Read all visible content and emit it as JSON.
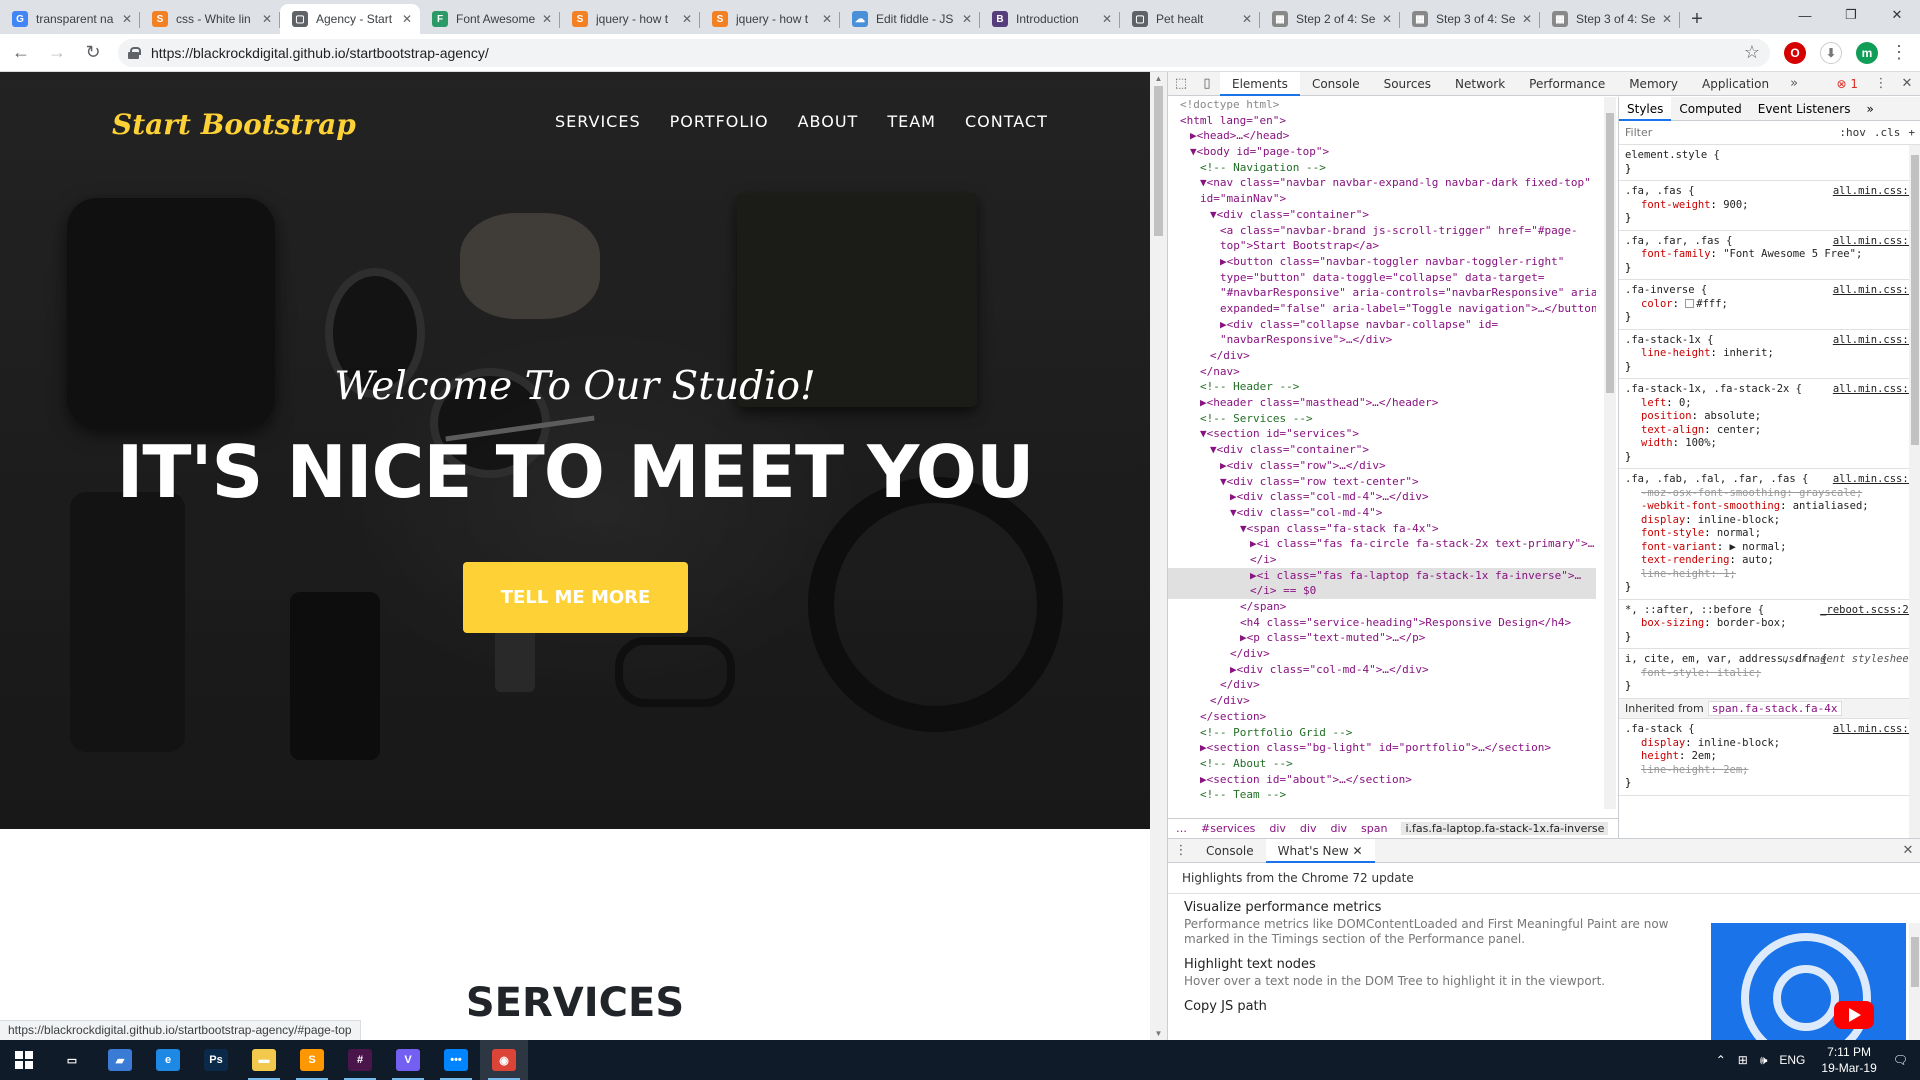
{
  "browser": {
    "tabs": [
      {
        "title": "transparent na",
        "fav": "G",
        "color": "#4285f4"
      },
      {
        "title": "css - White lin",
        "fav": "S",
        "color": "#f48024"
      },
      {
        "title": "Agency - Start",
        "fav": "▢",
        "color": "#5f6368",
        "active": true
      },
      {
        "title": "Font Awesome",
        "fav": "F",
        "color": "#2b9a66"
      },
      {
        "title": "jquery - how t",
        "fav": "S",
        "color": "#f48024"
      },
      {
        "title": "jquery - how t",
        "fav": "S",
        "color": "#f48024"
      },
      {
        "title": "Edit fiddle - JS",
        "fav": "☁",
        "color": "#4a90d9"
      },
      {
        "title": "Introduction",
        "fav": "B",
        "color": "#563d7c"
      },
      {
        "title": "Pet healt",
        "fav": "▢",
        "color": "#5f6368"
      },
      {
        "title": "Step 2 of 4: Se",
        "fav": "▦",
        "color": "#888888"
      },
      {
        "title": "Step 3 of 4: Se",
        "fav": "▦",
        "color": "#888888"
      },
      {
        "title": "Step 3 of 4: Se",
        "fav": "▦",
        "color": "#888888"
      }
    ],
    "url": "https://blackrockdigital.github.io/startbootstrap-agency/",
    "profile_initial": "m",
    "status_url": "https://blackrockdigital.github.io/startbootstrap-agency/#page-top"
  },
  "page": {
    "brand": "Start Bootstrap",
    "nav": [
      "SERVICES",
      "PORTFOLIO",
      "ABOUT",
      "TEAM",
      "CONTACT"
    ],
    "lead": "Welcome To Our Studio!",
    "heading": "IT'S NICE TO MEET YOU",
    "cta": "TELL ME MORE",
    "services_heading": "SERVICES"
  },
  "devtools": {
    "tabs": [
      "Elements",
      "Console",
      "Sources",
      "Network",
      "Performance",
      "Memory",
      "Application"
    ],
    "error_count": "1",
    "dom_lines": [
      {
        "i": 0,
        "t": "<!doctype html>",
        "k": "grey"
      },
      {
        "i": 0,
        "t": "<html lang=\"en\">",
        "k": "tag"
      },
      {
        "i": 1,
        "t": "▶<head>…</head>",
        "k": "tag"
      },
      {
        "i": 1,
        "t": "▼<body id=\"page-top\">",
        "k": "tag"
      },
      {
        "i": 2,
        "t": "<!-- Navigation -->",
        "k": "cmt"
      },
      {
        "i": 2,
        "t": "▼<nav class=\"navbar navbar-expand-lg navbar-dark fixed-top\"",
        "k": "tag"
      },
      {
        "i": 2,
        "t": "id=\"mainNav\">",
        "k": "tag"
      },
      {
        "i": 3,
        "t": "▼<div class=\"container\">",
        "k": "tag"
      },
      {
        "i": 4,
        "t": "<a class=\"navbar-brand js-scroll-trigger\" href=\"#page-",
        "k": "tag"
      },
      {
        "i": 4,
        "t": "top\">Start Bootstrap</a>",
        "k": "tag"
      },
      {
        "i": 4,
        "t": "▶<button class=\"navbar-toggler navbar-toggler-right\"",
        "k": "tag"
      },
      {
        "i": 4,
        "t": "type=\"button\" data-toggle=\"collapse\" data-target=",
        "k": "tag"
      },
      {
        "i": 4,
        "t": "\"#navbarResponsive\" aria-controls=\"navbarResponsive\" aria-",
        "k": "tag"
      },
      {
        "i": 4,
        "t": "expanded=\"false\" aria-label=\"Toggle navigation\">…</button>",
        "k": "tag"
      },
      {
        "i": 4,
        "t": "▶<div class=\"collapse navbar-collapse\" id=",
        "k": "tag"
      },
      {
        "i": 4,
        "t": "\"navbarResponsive\">…</div>",
        "k": "tag"
      },
      {
        "i": 3,
        "t": "</div>",
        "k": "tag"
      },
      {
        "i": 2,
        "t": "</nav>",
        "k": "tag"
      },
      {
        "i": 2,
        "t": "<!-- Header -->",
        "k": "cmt"
      },
      {
        "i": 2,
        "t": "▶<header class=\"masthead\">…</header>",
        "k": "tag"
      },
      {
        "i": 2,
        "t": "<!-- Services -->",
        "k": "cmt"
      },
      {
        "i": 2,
        "t": "▼<section id=\"services\">",
        "k": "tag"
      },
      {
        "i": 3,
        "t": "▼<div class=\"container\">",
        "k": "tag"
      },
      {
        "i": 4,
        "t": "▶<div class=\"row\">…</div>",
        "k": "tag"
      },
      {
        "i": 4,
        "t": "▼<div class=\"row text-center\">",
        "k": "tag"
      },
      {
        "i": 5,
        "t": "▶<div class=\"col-md-4\">…</div>",
        "k": "tag"
      },
      {
        "i": 5,
        "t": "▼<div class=\"col-md-4\">",
        "k": "tag"
      },
      {
        "i": 6,
        "t": "▼<span class=\"fa-stack fa-4x\">",
        "k": "tag"
      },
      {
        "i": 7,
        "t": "▶<i class=\"fas fa-circle fa-stack-2x text-primary\">…",
        "k": "tag"
      },
      {
        "i": 7,
        "t": "</i>",
        "k": "tag"
      },
      {
        "i": 7,
        "t": "▶<i class=\"fas fa-laptop fa-stack-1x fa-inverse\">…",
        "k": "tag",
        "sel": true
      },
      {
        "i": 7,
        "t": "</i> == $0",
        "k": "tag",
        "sel": true
      },
      {
        "i": 6,
        "t": "</span>",
        "k": "tag"
      },
      {
        "i": 6,
        "t": "<h4 class=\"service-heading\">Responsive Design</h4>",
        "k": "tag"
      },
      {
        "i": 6,
        "t": "▶<p class=\"text-muted\">…</p>",
        "k": "tag"
      },
      {
        "i": 5,
        "t": "</div>",
        "k": "tag"
      },
      {
        "i": 5,
        "t": "▶<div class=\"col-md-4\">…</div>",
        "k": "tag"
      },
      {
        "i": 4,
        "t": "</div>",
        "k": "tag"
      },
      {
        "i": 3,
        "t": "</div>",
        "k": "tag"
      },
      {
        "i": 2,
        "t": "</section>",
        "k": "tag"
      },
      {
        "i": 2,
        "t": "<!-- Portfolio Grid -->",
        "k": "cmt"
      },
      {
        "i": 2,
        "t": "▶<section class=\"bg-light\" id=\"portfolio\">…</section>",
        "k": "tag"
      },
      {
        "i": 2,
        "t": "<!-- About -->",
        "k": "cmt"
      },
      {
        "i": 2,
        "t": "▶<section id=\"about\">…</section>",
        "k": "tag"
      },
      {
        "i": 2,
        "t": "<!-- Team -->",
        "k": "cmt"
      }
    ],
    "breadcrumbs": [
      "…",
      "#services",
      "div",
      "div",
      "div",
      "span",
      "i.fas.fa-laptop.fa-stack-1x.fa-inverse"
    ],
    "style_tabs": [
      "Styles",
      "Computed",
      "Event Listeners"
    ],
    "filter_placeholder": "Filter",
    "hov": ":hov",
    "cls": ".cls",
    "rules": [
      {
        "sel": "element.style {",
        "src": "",
        "decls": []
      },
      {
        "sel": ".fa, .fas {",
        "src": "all.min.css:5",
        "decls": [
          {
            "p": "font-weight",
            "v": "900;"
          }
        ]
      },
      {
        "sel": ".fa, .far, .fas {",
        "src": "all.min.css:5",
        "decls": [
          {
            "p": "font-family",
            "v": "\"Font Awesome 5 Free\";"
          }
        ]
      },
      {
        "sel": ".fa-inverse {",
        "src": "all.min.css:5",
        "decls": [
          {
            "p": "color",
            "v": "#fff;",
            "swatch": true
          }
        ]
      },
      {
        "sel": ".fa-stack-1x {",
        "src": "all.min.css:5",
        "decls": [
          {
            "p": "line-height",
            "v": "inherit;"
          }
        ]
      },
      {
        "sel": ".fa-stack-1x, .fa-stack-2x {",
        "src": "all.min.css:5",
        "decls": [
          {
            "p": "left",
            "v": "0;"
          },
          {
            "p": "position",
            "v": "absolute;"
          },
          {
            "p": "text-align",
            "v": "center;"
          },
          {
            "p": "width",
            "v": "100%;"
          }
        ]
      },
      {
        "sel": ".fa, .fab, .fal, .far, .fas {",
        "src": "all.min.css:5",
        "decls": [
          {
            "p": "-moz-osx-font-smoothing",
            "v": "grayscale;",
            "strike": true
          },
          {
            "p": "-webkit-font-smoothing",
            "v": "antialiased;"
          },
          {
            "p": "display",
            "v": "inline-block;"
          },
          {
            "p": "font-style",
            "v": "normal;"
          },
          {
            "p": "font-variant",
            "v": "▶ normal;"
          },
          {
            "p": "text-rendering",
            "v": "auto;"
          },
          {
            "p": "line-height",
            "v": "1;",
            "strike": true
          }
        ]
      },
      {
        "sel": "*, ::after, ::before {",
        "src": "_reboot.scss:22",
        "decls": [
          {
            "p": "box-sizing",
            "v": "border-box;"
          }
        ]
      },
      {
        "sel": "i, cite, em, var, address, dfn {",
        "src": "user agent stylesheet",
        "plainsrc": true,
        "decls": [
          {
            "p": "font-style",
            "v": "italic;",
            "strike": true
          }
        ]
      }
    ],
    "inherited_label": "Inherited from",
    "inherited_chip": "span.fa-stack.fa-4x",
    "inherited_rule": {
      "sel": ".fa-stack {",
      "src": "all.min.css:5",
      "decls": [
        {
          "p": "display",
          "v": "inline-block;"
        },
        {
          "p": "height",
          "v": "2em;"
        },
        {
          "p": "line-height",
          "v": "2em;",
          "strike": true
        }
      ]
    },
    "drawer": {
      "tabs": [
        "Console",
        "What's New"
      ],
      "highlights": "Highlights from the Chrome 72 update",
      "features": [
        {
          "title": "Visualize performance metrics",
          "desc": "Performance metrics like DOMContentLoaded and First Meaningful Paint are now marked in the Timings section of the Performance panel."
        },
        {
          "title": "Highlight text nodes",
          "desc": "Hover over a text node in the DOM Tree to highlight it in the viewport."
        },
        {
          "title": "Copy JS path",
          "desc": ""
        }
      ]
    }
  },
  "taskbar": {
    "apps": [
      {
        "name": "task-view",
        "glyph": "▭",
        "color": "#101b29"
      },
      {
        "name": "file-explorer-pinned",
        "glyph": "▰",
        "color": "#3a7bd5"
      },
      {
        "name": "edge",
        "glyph": "e",
        "color": "#1e88e5"
      },
      {
        "name": "photoshop",
        "glyph": "Ps",
        "color": "#0b2a4a"
      },
      {
        "name": "file-explorer",
        "glyph": "▬",
        "color": "#f2c94c"
      },
      {
        "name": "sublime",
        "glyph": "S",
        "color": "#ff9800"
      },
      {
        "name": "slack",
        "glyph": "#",
        "color": "#4a154b"
      },
      {
        "name": "viber",
        "glyph": "V",
        "color": "#7360f2"
      },
      {
        "name": "messenger",
        "glyph": "•••",
        "color": "#0084ff"
      },
      {
        "name": "chrome",
        "glyph": "◉",
        "color": "#db4437"
      }
    ],
    "lang": "ENG",
    "time": "7:11 PM",
    "date": "19-Mar-19"
  }
}
